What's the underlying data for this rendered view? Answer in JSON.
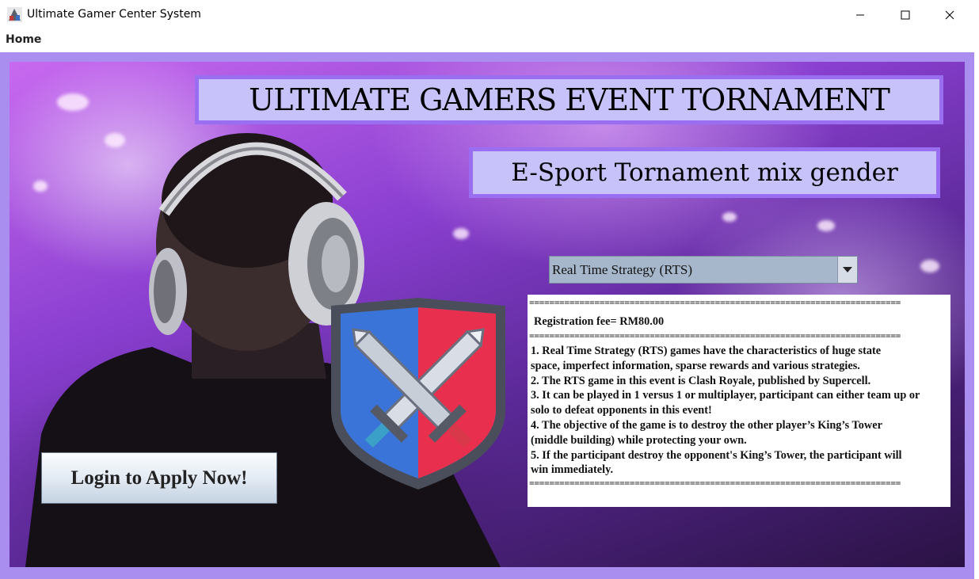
{
  "window": {
    "title": "Ultimate Gamer Center System"
  },
  "menu": {
    "home": "Home"
  },
  "banner": {
    "title": "ULTIMATE GAMERS EVENT TORNAMENT",
    "subtitle": "E-Sport Tornament mix gender"
  },
  "dropdown": {
    "selected": "Real Time Strategy (RTS)"
  },
  "info": {
    "separator": "==========================================================================",
    "fee": "Registration fee= RM80.00",
    "lines": [
      "1. Real Time Strategy (RTS) games have the characteristics of huge state",
      "space, imperfect information, sparse rewards and various strategies.",
      "2. The RTS game in this event is Clash Royale, published by Supercell.",
      "3. It can be played in 1 versus 1 or multiplayer, participant can either team up or",
      "solo to defeat opponents in this event!",
      "4. The objective of the game is to destroy the other player’s King’s Tower",
      "(middle building) while protecting your own.",
      "5. If the participant destroy the opponent's King’s Tower, the participant will",
      "win immediately."
    ]
  },
  "login_button": {
    "label": "Login to Apply Now!"
  },
  "icons": {
    "app": "gamer-app-icon",
    "emblem": "crossed-swords-shield-icon",
    "dropdown": "chevron-down-icon"
  },
  "colors": {
    "frame": "#a98ef0",
    "banner_fill": "#c7c3fa",
    "banner_border": "#9a6ef0",
    "dropdown": "#a6b7cc",
    "shield_blue": "#3a74d8",
    "shield_red": "#e8304e"
  }
}
